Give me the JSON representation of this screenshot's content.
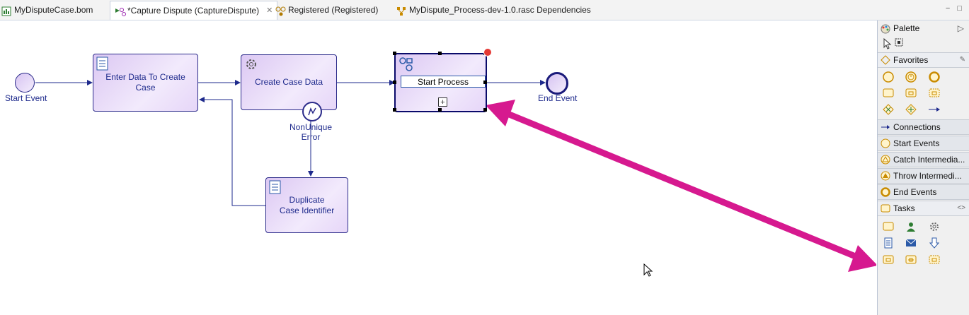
{
  "tabs": [
    {
      "label": "MyDisputeCase.bom"
    },
    {
      "label": "*Capture Dispute (CaptureDispute)",
      "close": "✕"
    },
    {
      "label": "Registered (Registered)"
    },
    {
      "label": "MyDispute_Process-dev-1.0.rasc Dependencies"
    }
  ],
  "window_buttons": {
    "minimize": "−",
    "maximize": "□"
  },
  "diagram": {
    "start_event_label": "Start Event",
    "end_event_label": "End Event",
    "task_enter_data": [
      "Enter Data To Create",
      "Case"
    ],
    "task_create_case": "Create Case Data",
    "boundary_error_label": [
      "NonUnique",
      "Error"
    ],
    "task_duplicate": [
      "Duplicate",
      "Case Identifier"
    ],
    "subprocess_edit_value": "Start Process",
    "expand_marker": "+"
  },
  "palette": {
    "title": "Palette",
    "drawers": {
      "favorites": "Favorites",
      "connections": "Connections",
      "start_events": "Start Events",
      "catch_intermediate": "Catch Intermedia...",
      "throw_intermediate": "Throw Intermedi...",
      "end_events": "End Events",
      "tasks": "Tasks"
    }
  },
  "colors": {
    "accent_arrow": "#d6198f",
    "task_border": "#2b2b8a",
    "task_fill": "#e6d6f8",
    "event_orange": "#c98b00"
  }
}
